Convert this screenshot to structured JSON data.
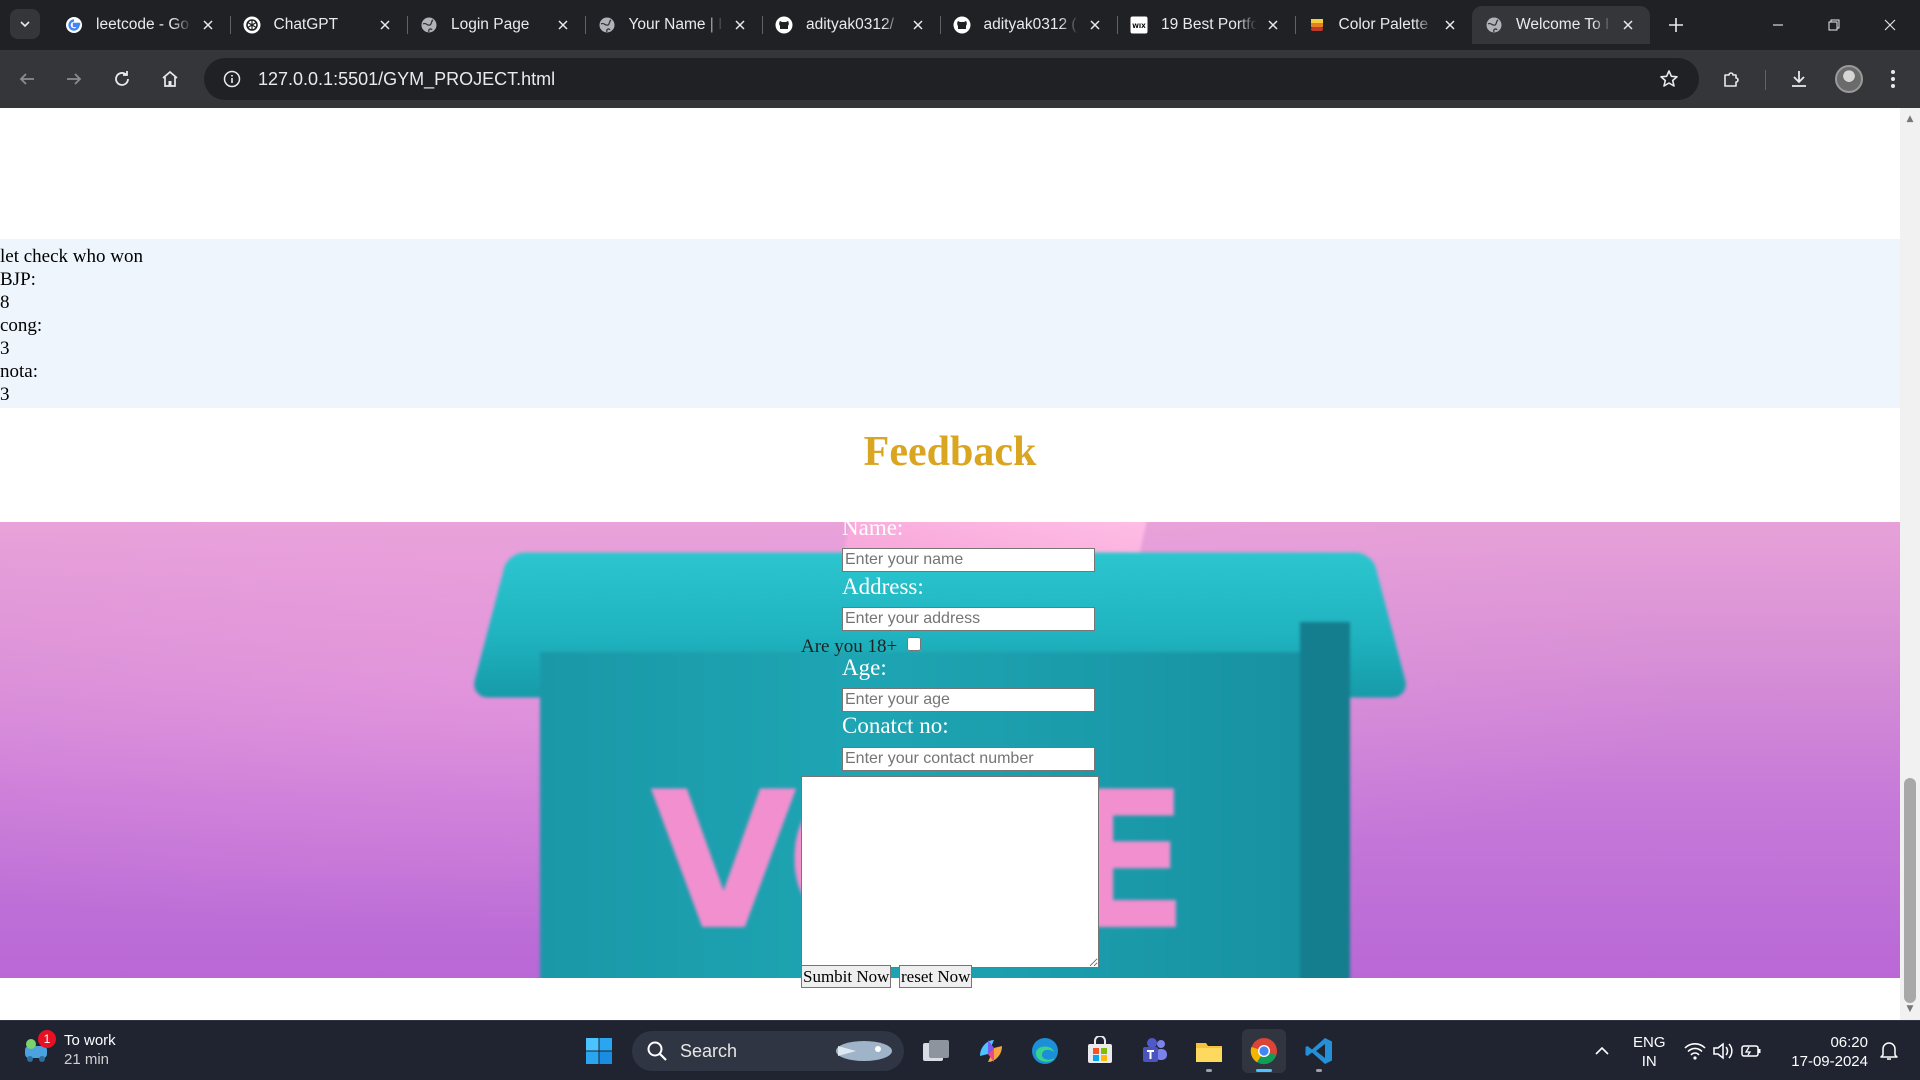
{
  "browser": {
    "tabs": [
      {
        "title": "leetcode - Go",
        "favicon": "google-icon"
      },
      {
        "title": "ChatGPT",
        "favicon": "chatgpt-icon"
      },
      {
        "title": "Login Page",
        "favicon": "globe-icon"
      },
      {
        "title": "Your Name | I",
        "favicon": "globe-icon"
      },
      {
        "title": "adityak0312/",
        "favicon": "github-icon"
      },
      {
        "title": "adityak0312 (",
        "favicon": "github-icon"
      },
      {
        "title": "19 Best Portfo",
        "favicon": "wix-icon"
      },
      {
        "title": "Color Palette",
        "favicon": "palette-icon"
      },
      {
        "title": "Welcome To I",
        "favicon": "globe-icon",
        "active": true
      }
    ],
    "url": "127.0.0.1:5501/GYM_PROJECT.html"
  },
  "page": {
    "results": {
      "heading": "let check who won",
      "bjp_label": "BJP:",
      "bjp_value": "8",
      "cong_label": "cong:",
      "cong_value": "3",
      "nota_label": "nota:",
      "nota_value": "3"
    },
    "feedback": {
      "title": "Feedback",
      "title_color": "#daa520",
      "name_label": "Name:",
      "name_placeholder": "Enter your name",
      "address_label": "Address:",
      "address_placeholder": "Enter your address",
      "adult_label": "Are you 18+",
      "age_label": "Age:",
      "age_placeholder": "Enter your age",
      "contact_label": "Conatct no:",
      "contact_placeholder": "Enter your contact number",
      "submit_label": "Sumbit Now",
      "reset_label": "reset Now"
    },
    "background_image": {
      "letters": [
        "V",
        "O",
        "E"
      ]
    }
  },
  "taskbar": {
    "weather_title": "To work",
    "weather_sub": "21 min",
    "weather_badge": "1",
    "search_label": "Search",
    "lang_line1": "ENG",
    "lang_line2": "IN",
    "time": "06:20",
    "date": "17-09-2024",
    "accent_color": "#4cc2ff"
  }
}
